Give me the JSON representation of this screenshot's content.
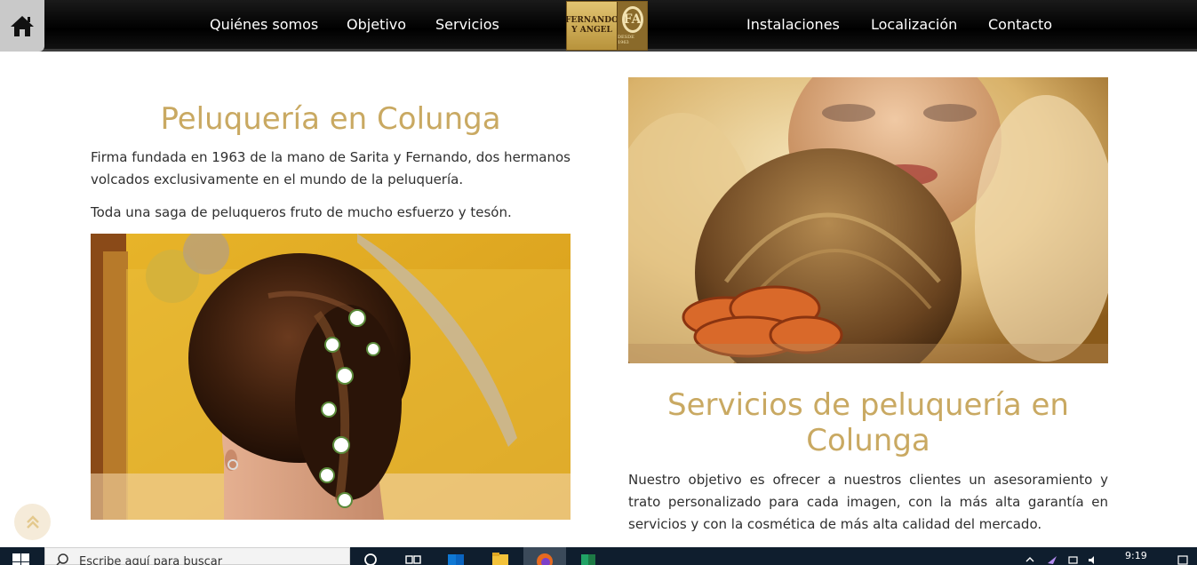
{
  "nav": {
    "left_items": [
      "Quiénes somos",
      "Objetivo",
      "Servicios"
    ],
    "right_items": [
      "Instalaciones",
      "Localización",
      "Contacto"
    ],
    "logo": {
      "line1": "FERNANDO",
      "line2": "Y ANGEL",
      "mark": "FA",
      "since": "DESDE 1963"
    },
    "icons": {
      "home": "home-icon"
    }
  },
  "section1": {
    "title": "Peluquería en Colunga",
    "paragraph1": "Firma fundada en 1963 de la mano de Sarita y Fernando, dos hermanos volcados exclusivamente en el mundo de la peluquería.",
    "paragraph2": "Toda una saga de peluqueros fruto de mucho esfuerzo y tesón."
  },
  "section2": {
    "title_line1": "Servicios de peluquería en",
    "title_line2": "Colunga",
    "paragraph": "Nuestro objetivo es ofrecer a nuestros clientes un asesoramiento y trato personalizado para cada imagen, con la más alta garantía en servicios y con la cosmética de más alta calidad del mercado."
  },
  "taskbar": {
    "search_placeholder": "Escribe aquí para buscar",
    "time": "9:19"
  },
  "colors": {
    "accent": "#c9a962",
    "nav_bg": "#000000",
    "taskbar_bg": "#0f1e2e"
  }
}
